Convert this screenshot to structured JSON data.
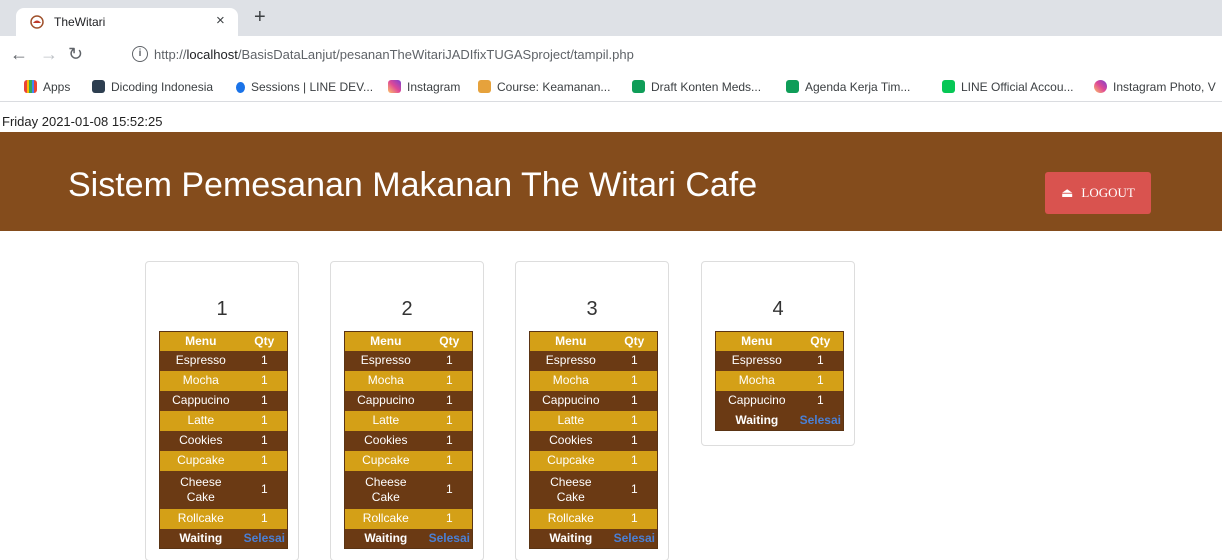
{
  "browser": {
    "tab_title": "TheWitari",
    "url_prefix": "http://",
    "url_host": "localhost",
    "url_path": "/BasisDataLanjut/pesananTheWitariJADIfixTUGASproject/tampil.php",
    "bookmarks": [
      "Apps",
      "Dicoding Indonesia",
      "Sessions | LINE DEV...",
      "Instagram",
      "Course: Keamanan...",
      "Draft Konten Meds...",
      "Agenda Kerja Tim...",
      "LINE Official Accou...",
      "Instagram Photo, V"
    ]
  },
  "datetime": "Friday 2021-01-08 15:52:25",
  "header": {
    "title": "Sistem Pemesanan Makanan The Witari Cafe",
    "logout_label": "LOGOUT"
  },
  "table_headers": {
    "menu": "Menu",
    "qty": "Qty"
  },
  "status": {
    "waiting": "Waiting",
    "selesai": "Selesai"
  },
  "orders": [
    {
      "number": "1",
      "items": [
        {
          "menu": "Espresso",
          "qty": "1"
        },
        {
          "menu": "Mocha",
          "qty": "1"
        },
        {
          "menu": "Cappucino",
          "qty": "1"
        },
        {
          "menu": "Latte",
          "qty": "1"
        },
        {
          "menu": "Cookies",
          "qty": "1"
        },
        {
          "menu": "Cupcake",
          "qty": "1"
        },
        {
          "menu": "Cheese Cake",
          "qty": "1"
        },
        {
          "menu": "Rollcake",
          "qty": "1"
        }
      ]
    },
    {
      "number": "2",
      "items": [
        {
          "menu": "Espresso",
          "qty": "1"
        },
        {
          "menu": "Mocha",
          "qty": "1"
        },
        {
          "menu": "Cappucino",
          "qty": "1"
        },
        {
          "menu": "Latte",
          "qty": "1"
        },
        {
          "menu": "Cookies",
          "qty": "1"
        },
        {
          "menu": "Cupcake",
          "qty": "1"
        },
        {
          "menu": "Cheese Cake",
          "qty": "1"
        },
        {
          "menu": "Rollcake",
          "qty": "1"
        }
      ]
    },
    {
      "number": "3",
      "items": [
        {
          "menu": "Espresso",
          "qty": "1"
        },
        {
          "menu": "Mocha",
          "qty": "1"
        },
        {
          "menu": "Cappucino",
          "qty": "1"
        },
        {
          "menu": "Latte",
          "qty": "1"
        },
        {
          "menu": "Cookies",
          "qty": "1"
        },
        {
          "menu": "Cupcake",
          "qty": "1"
        },
        {
          "menu": "Cheese Cake",
          "qty": "1"
        },
        {
          "menu": "Rollcake",
          "qty": "1"
        }
      ]
    },
    {
      "number": "4",
      "items": [
        {
          "menu": "Espresso",
          "qty": "1"
        },
        {
          "menu": "Mocha",
          "qty": "1"
        },
        {
          "menu": "Cappucino",
          "qty": "1"
        }
      ]
    }
  ],
  "colors": {
    "header_bg": "#844c1c",
    "row_dark": "#6b3a14",
    "row_gold": "#d4a017",
    "logout_bg": "#d9534f",
    "selesai_link": "#4a7fd4"
  }
}
